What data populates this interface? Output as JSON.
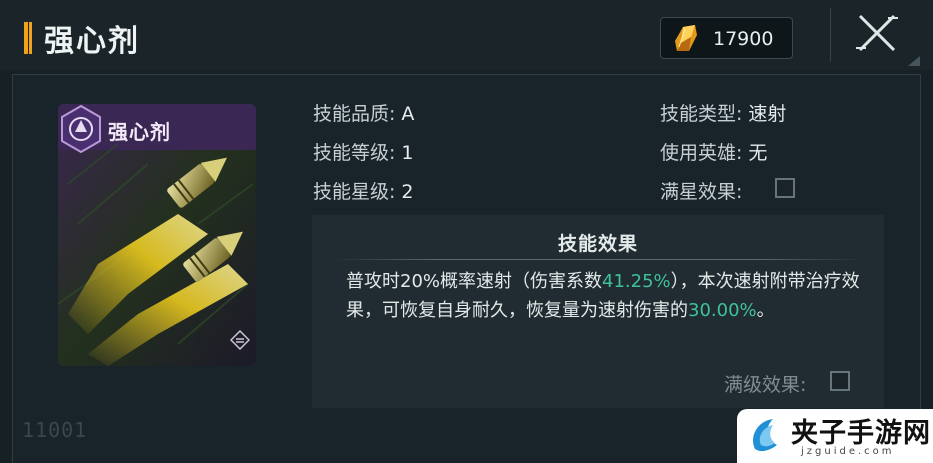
{
  "header": {
    "title": "强心剂",
    "currency_value": "17900",
    "currency_icon": "crystal-icon",
    "close_icon": "close-icon"
  },
  "card": {
    "name": "强心剂",
    "badge_icon": "faction-badge-icon",
    "corner_icon": "stack-icon"
  },
  "stats": {
    "quality_label": "技能品质:",
    "quality_value": "A",
    "level_label": "技能等级:",
    "level_value": "1",
    "star_label": "技能星级:",
    "star_value": "2",
    "type_label": "技能类型:",
    "type_value": "速射",
    "hero_label": "使用英雄:",
    "hero_value": "无",
    "max_star_label": "满星效果:"
  },
  "effect": {
    "title": "技能效果",
    "text_1": "普攻时20%概率速射（伤害系数",
    "highlight_1": "41.25%",
    "text_2": "），本次速射附带治疗效果，可恢复自身耐久，恢复量为速射伤害的",
    "highlight_2": "30.00%",
    "text_3": "。",
    "max_level_label": "满级效果:"
  },
  "footer": {
    "serial": "11001"
  },
  "watermark": {
    "name": "夹子手游网",
    "url": "jzguide.com"
  },
  "colors": {
    "accent": "#f0a21c",
    "highlight": "#3fc19a",
    "card_purple": "#6b3d9a"
  }
}
